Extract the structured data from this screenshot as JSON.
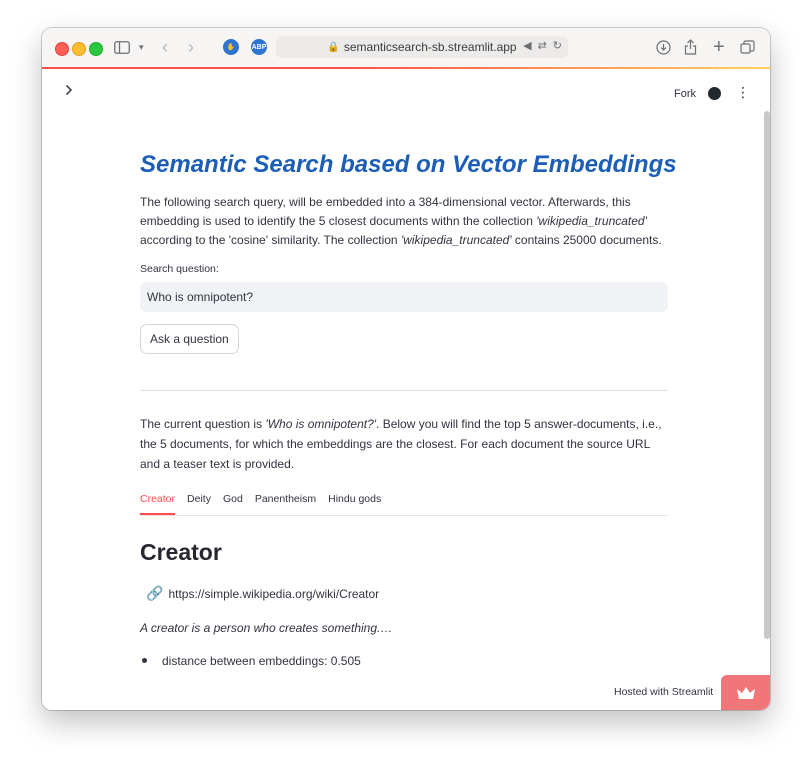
{
  "browser": {
    "url": "semanticsearch-sb.streamlit.app",
    "extensions": [
      {
        "name": "hand-extension-icon",
        "color": "#2f74d0"
      },
      {
        "name": "abp-extension-icon",
        "label": "ABP",
        "color": "#2f74d0"
      }
    ]
  },
  "toolbar": {
    "fork_label": "Fork"
  },
  "main": {
    "title": "Semantic Search based on Vector Embeddings",
    "intro": {
      "p1": "The following search query, will be embedded into a 384-dimensional vector. Afterwards, this embedding is used to identify the 5 closest documents withn the collection ",
      "collection": "'wikipedia_truncated'",
      "p2": " according to the 'cosine' similarity. The collection ",
      "p3": " contains 25000 documents."
    },
    "search": {
      "label": "Search question:",
      "value": "Who is omnipotent?"
    },
    "ask_button": "Ask a question",
    "answer": {
      "p1": "The current question is ",
      "question": "'Who is omnipotent?'",
      "p2": ". Below you will find the top 5 answer-documents, i.e., the 5 documents, for which the embeddings are the closest. For each document the source URL and a teaser text is provided."
    },
    "tabs": [
      {
        "label": "Creator",
        "active": true
      },
      {
        "label": "Deity",
        "active": false
      },
      {
        "label": "God",
        "active": false
      },
      {
        "label": "Panentheism",
        "active": false
      },
      {
        "label": "Hindu gods",
        "active": false
      }
    ],
    "document": {
      "heading": "Creator",
      "url": "https://simple.wikipedia.org/wiki/Creator",
      "teaser": "A creator is a person who creates something.…",
      "distance": "distance between embeddings: 0.505"
    }
  },
  "footer": {
    "hosted": "Hosted with Streamlit"
  },
  "colors": {
    "accent": "#ff4b4b",
    "title_blue": "#1c5eb7",
    "badge": "#f0767a"
  }
}
